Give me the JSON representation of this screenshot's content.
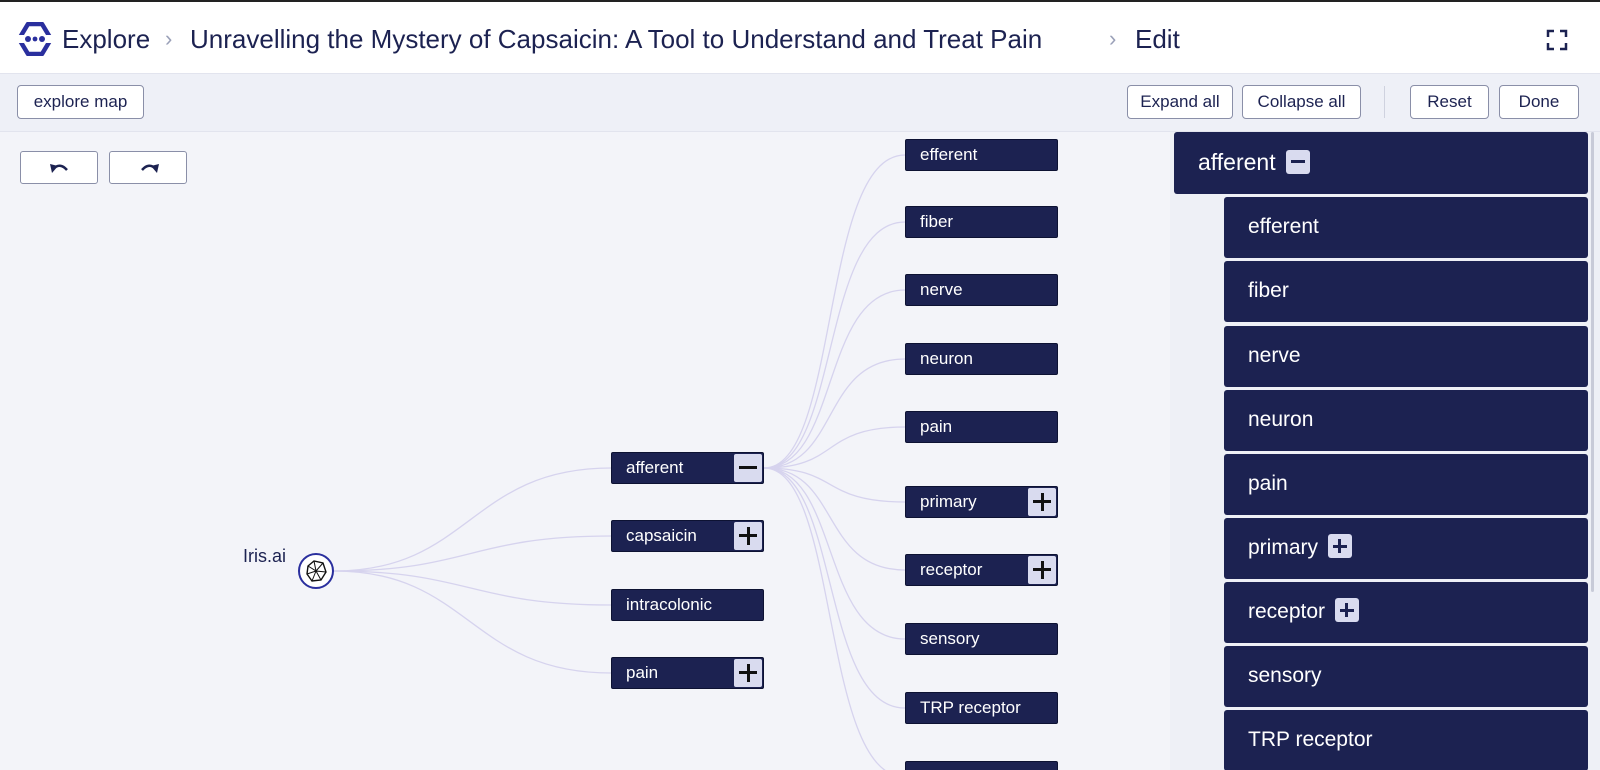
{
  "header": {
    "explore": "Explore",
    "title": "Unravelling the Mystery of Capsaicin: A Tool to Understand and Treat Pain",
    "mode": "Edit",
    "separator": "›"
  },
  "toolbar": {
    "explore_map": "explore map",
    "expand_all": "Expand all",
    "collapse_all": "Collapse all",
    "reset": "Reset",
    "done": "Done"
  },
  "tree": {
    "root": "Iris.ai",
    "level1": [
      {
        "label": "afferent",
        "toggle": "minus"
      },
      {
        "label": "capsaicin",
        "toggle": "plus"
      },
      {
        "label": "intracolonic",
        "toggle": "none"
      },
      {
        "label": "pain",
        "toggle": "plus"
      }
    ],
    "level2": [
      {
        "label": "efferent",
        "toggle": "none"
      },
      {
        "label": "fiber",
        "toggle": "none"
      },
      {
        "label": "nerve",
        "toggle": "none"
      },
      {
        "label": "neuron",
        "toggle": "none"
      },
      {
        "label": "pain",
        "toggle": "none"
      },
      {
        "label": "primary",
        "toggle": "plus"
      },
      {
        "label": "receptor",
        "toggle": "plus"
      },
      {
        "label": "sensory",
        "toggle": "none"
      },
      {
        "label": "TRP receptor",
        "toggle": "none"
      }
    ]
  },
  "panel": {
    "header": "afferent",
    "items": [
      {
        "label": "efferent",
        "toggle": "none"
      },
      {
        "label": "fiber",
        "toggle": "none"
      },
      {
        "label": "nerve",
        "toggle": "none"
      },
      {
        "label": "neuron",
        "toggle": "none"
      },
      {
        "label": "pain",
        "toggle": "none"
      },
      {
        "label": "primary",
        "toggle": "plus"
      },
      {
        "label": "receptor",
        "toggle": "plus"
      },
      {
        "label": "sensory",
        "toggle": "none"
      },
      {
        "label": "TRP receptor",
        "toggle": "none"
      }
    ]
  },
  "colors": {
    "node": "#1c2251",
    "toggle": "#d9dbef",
    "link": "#d6d3ee",
    "accent": "#2a2f9e"
  },
  "icons": [
    "iris-logo-icon",
    "fullscreen-icon",
    "undo-icon",
    "redo-icon",
    "iris-ai-icon",
    "plus-icon",
    "minus-icon"
  ]
}
